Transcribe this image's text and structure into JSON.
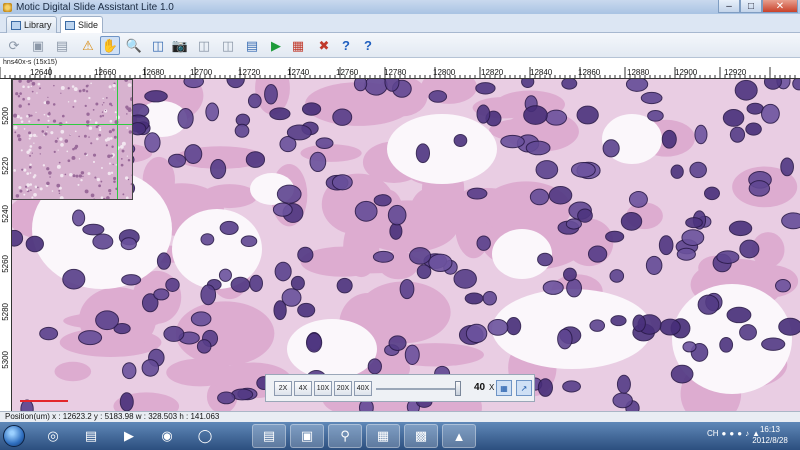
{
  "window": {
    "title": "Motic Digital Slide Assistant Lite 1.0"
  },
  "tabs": [
    {
      "label": "Library",
      "active": false
    },
    {
      "label": "Slide",
      "active": true
    }
  ],
  "toolbar_icons": [
    "rotate-icon",
    "save-icon",
    "save-as-icon",
    "info-icon",
    "hand-icon",
    "magnifier-icon",
    "fit-view-icon",
    "camera-icon",
    "copy-icon",
    "compare-icon",
    "export-icon",
    "play-icon",
    "color-adjust-icon",
    "tools-icon",
    "help-icon",
    "about-icon"
  ],
  "viewer": {
    "label": "hns40x-s (15x15)",
    "ruler_x": [
      "12640",
      "12660",
      "12680",
      "12700",
      "12720",
      "12740",
      "12760",
      "12780",
      "12800",
      "12820",
      "12840",
      "12860",
      "12880",
      "12900",
      "12920"
    ],
    "ruler_y": [
      "5200",
      "5220",
      "5240",
      "5260",
      "5280",
      "5300"
    ]
  },
  "zoom": {
    "buttons": [
      "2X",
      "4X",
      "10X",
      "20X",
      "40X"
    ],
    "current": "40",
    "unit": "X",
    "level_fraction": 1.0
  },
  "status": {
    "text": "Position(um) x : 12623.2  y : 5183.98  w : 328.503  h : 141.063"
  },
  "taskbar": {
    "apps": [
      "ie-icon",
      "explorer-icon",
      "media-icon",
      "chrome-icon",
      "browser-icon",
      "folder-icon",
      "paint-icon",
      "search-icon",
      "office-icon",
      "motic-icon",
      "game-icon"
    ],
    "tray": {
      "lang": "CH"
    },
    "clock": {
      "time": "16:13",
      "date": "2012/8/28"
    }
  },
  "colors": {
    "accent": "#6e94c5",
    "scale_bar": "#e3262b",
    "overview_crosshair": "#2ecc40"
  }
}
